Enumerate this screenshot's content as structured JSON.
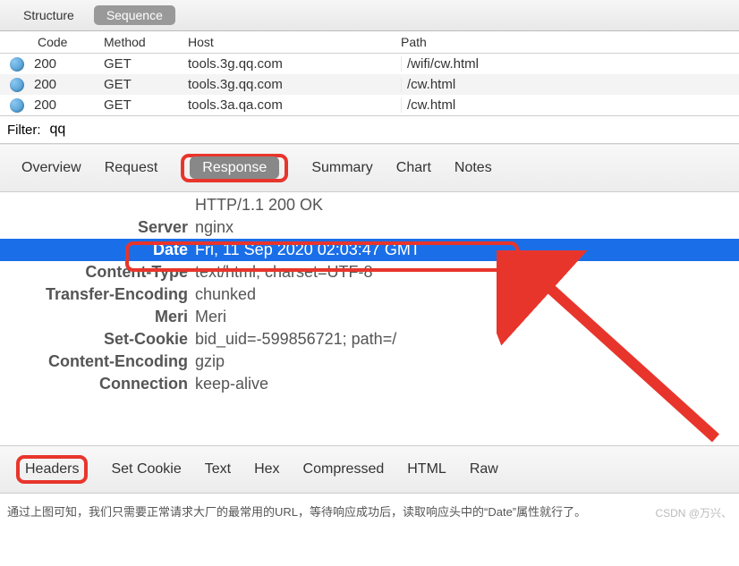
{
  "topTabs": {
    "structure": "Structure",
    "sequence": "Sequence"
  },
  "columns": {
    "code": "Code",
    "method": "Method",
    "host": "Host",
    "path": "Path"
  },
  "rows": [
    {
      "code": "200",
      "method": "GET",
      "host": "tools.3g.qq.com",
      "path": "/wifi/cw.html"
    },
    {
      "code": "200",
      "method": "GET",
      "host": "tools.3g.qq.com",
      "path": "/cw.html"
    },
    {
      "code": "200",
      "method": "GET",
      "host": "tools.3a.qa.com",
      "path": "/cw.html"
    }
  ],
  "filter": {
    "label": "Filter:",
    "value": "qq"
  },
  "detailTabs": {
    "overview": "Overview",
    "request": "Request",
    "response": "Response",
    "summary": "Summary",
    "chart": "Chart",
    "notes": "Notes"
  },
  "response": {
    "statusLine": "HTTP/1.1 200 OK",
    "headers": [
      {
        "name": "Server",
        "value": "nginx"
      },
      {
        "name": "Date",
        "value": "Fri, 11 Sep 2020 02:03:47 GMT"
      },
      {
        "name": "Content-Type",
        "value": "text/html; charset=UTF-8"
      },
      {
        "name": "Transfer-Encoding",
        "value": "chunked"
      },
      {
        "name": "Meri",
        "value": "Meri"
      },
      {
        "name": "Set-Cookie",
        "value": "bid_uid=-599856721; path=/"
      },
      {
        "name": "Content-Encoding",
        "value": "gzip"
      },
      {
        "name": "Connection",
        "value": "keep-alive"
      }
    ]
  },
  "bottomTabs": {
    "headers": "Headers",
    "setcookie": "Set Cookie",
    "text": "Text",
    "hex": "Hex",
    "compressed": "Compressed",
    "html": "HTML",
    "raw": "Raw"
  },
  "caption": "通过上图可知，我们只需要正常请求大厂的最常用的URL，等待响应成功后，读取响应头中的“Date”属性就行了。",
  "watermark": "CSDN @万兴、"
}
